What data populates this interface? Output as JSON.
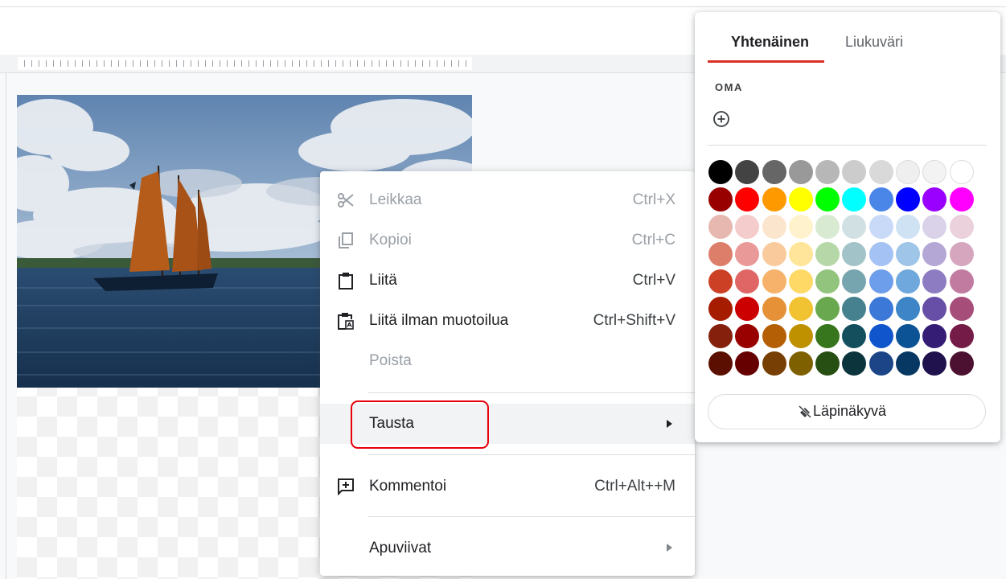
{
  "context_menu": {
    "items": [
      {
        "label": "Leikkaa",
        "shortcut": "Ctrl+X",
        "icon": "scissors-icon",
        "disabled": true
      },
      {
        "label": "Kopioi",
        "shortcut": "Ctrl+C",
        "icon": "copy-icon",
        "disabled": true
      },
      {
        "label": "Liitä",
        "shortcut": "Ctrl+V",
        "icon": "clipboard-icon",
        "disabled": false
      },
      {
        "label": "Liitä ilman muotoilua",
        "shortcut": "Ctrl+Shift+V",
        "icon": "clipboard-text-icon",
        "disabled": false
      },
      {
        "label": "Poista",
        "shortcut": "",
        "icon": "",
        "disabled": true
      },
      {
        "label": "Tausta",
        "shortcut": "",
        "icon": "",
        "has_submenu": true,
        "highlighted": true
      },
      {
        "label": "Kommentoi",
        "shortcut": "Ctrl+Alt++M",
        "icon": "add-comment-icon",
        "disabled": false
      },
      {
        "label": "Apuviivat",
        "shortcut": "",
        "icon": "",
        "has_submenu": true
      }
    ]
  },
  "color_panel": {
    "tabs": [
      "Yhtenäinen",
      "Liukuväri"
    ],
    "active_tab": "Yhtenäinen",
    "custom_label": "OMA",
    "transparent_label": "Läpinäkyvä",
    "swatches": [
      [
        "#000000",
        "#434343",
        "#666666",
        "#999999",
        "#b7b7b7",
        "#cccccc",
        "#d9d9d9",
        "#efefef",
        "#f3f3f3",
        "#ffffff"
      ],
      [
        "#980000",
        "#ff0000",
        "#ff9900",
        "#ffff00",
        "#00ff00",
        "#00ffff",
        "#4a86e8",
        "#0000ff",
        "#9900ff",
        "#ff00ff"
      ],
      [
        "#e6b8af",
        "#f4cccc",
        "#fce5cd",
        "#fff2cc",
        "#d9ead3",
        "#d0e0e3",
        "#c9daf8",
        "#cfe2f3",
        "#d9d2e9",
        "#ead1dc"
      ],
      [
        "#dd7e6b",
        "#ea9999",
        "#f9cb9c",
        "#ffe599",
        "#b6d7a8",
        "#a2c4c9",
        "#a4c2f4",
        "#9fc5e8",
        "#b4a7d6",
        "#d5a6bd"
      ],
      [
        "#cc4125",
        "#e06666",
        "#f6b26b",
        "#ffd966",
        "#93c47d",
        "#76a5af",
        "#6d9eeb",
        "#6fa8dc",
        "#8e7cc3",
        "#c27ba0"
      ],
      [
        "#a61c00",
        "#cc0000",
        "#e69138",
        "#f1c232",
        "#6aa84f",
        "#45818e",
        "#3c78d8",
        "#3d85c6",
        "#674ea7",
        "#a64d79"
      ],
      [
        "#85200c",
        "#990000",
        "#b45f06",
        "#bf9000",
        "#38761d",
        "#134f5c",
        "#1155cc",
        "#0b5394",
        "#351c75",
        "#741b47"
      ],
      [
        "#5b0f00",
        "#660000",
        "#783f04",
        "#7f6000",
        "#274e13",
        "#0c343d",
        "#1c4587",
        "#073763",
        "#20124d",
        "#4c1130"
      ]
    ],
    "accent_color": "#d93025"
  },
  "highlight_box_color": "#e8000b"
}
